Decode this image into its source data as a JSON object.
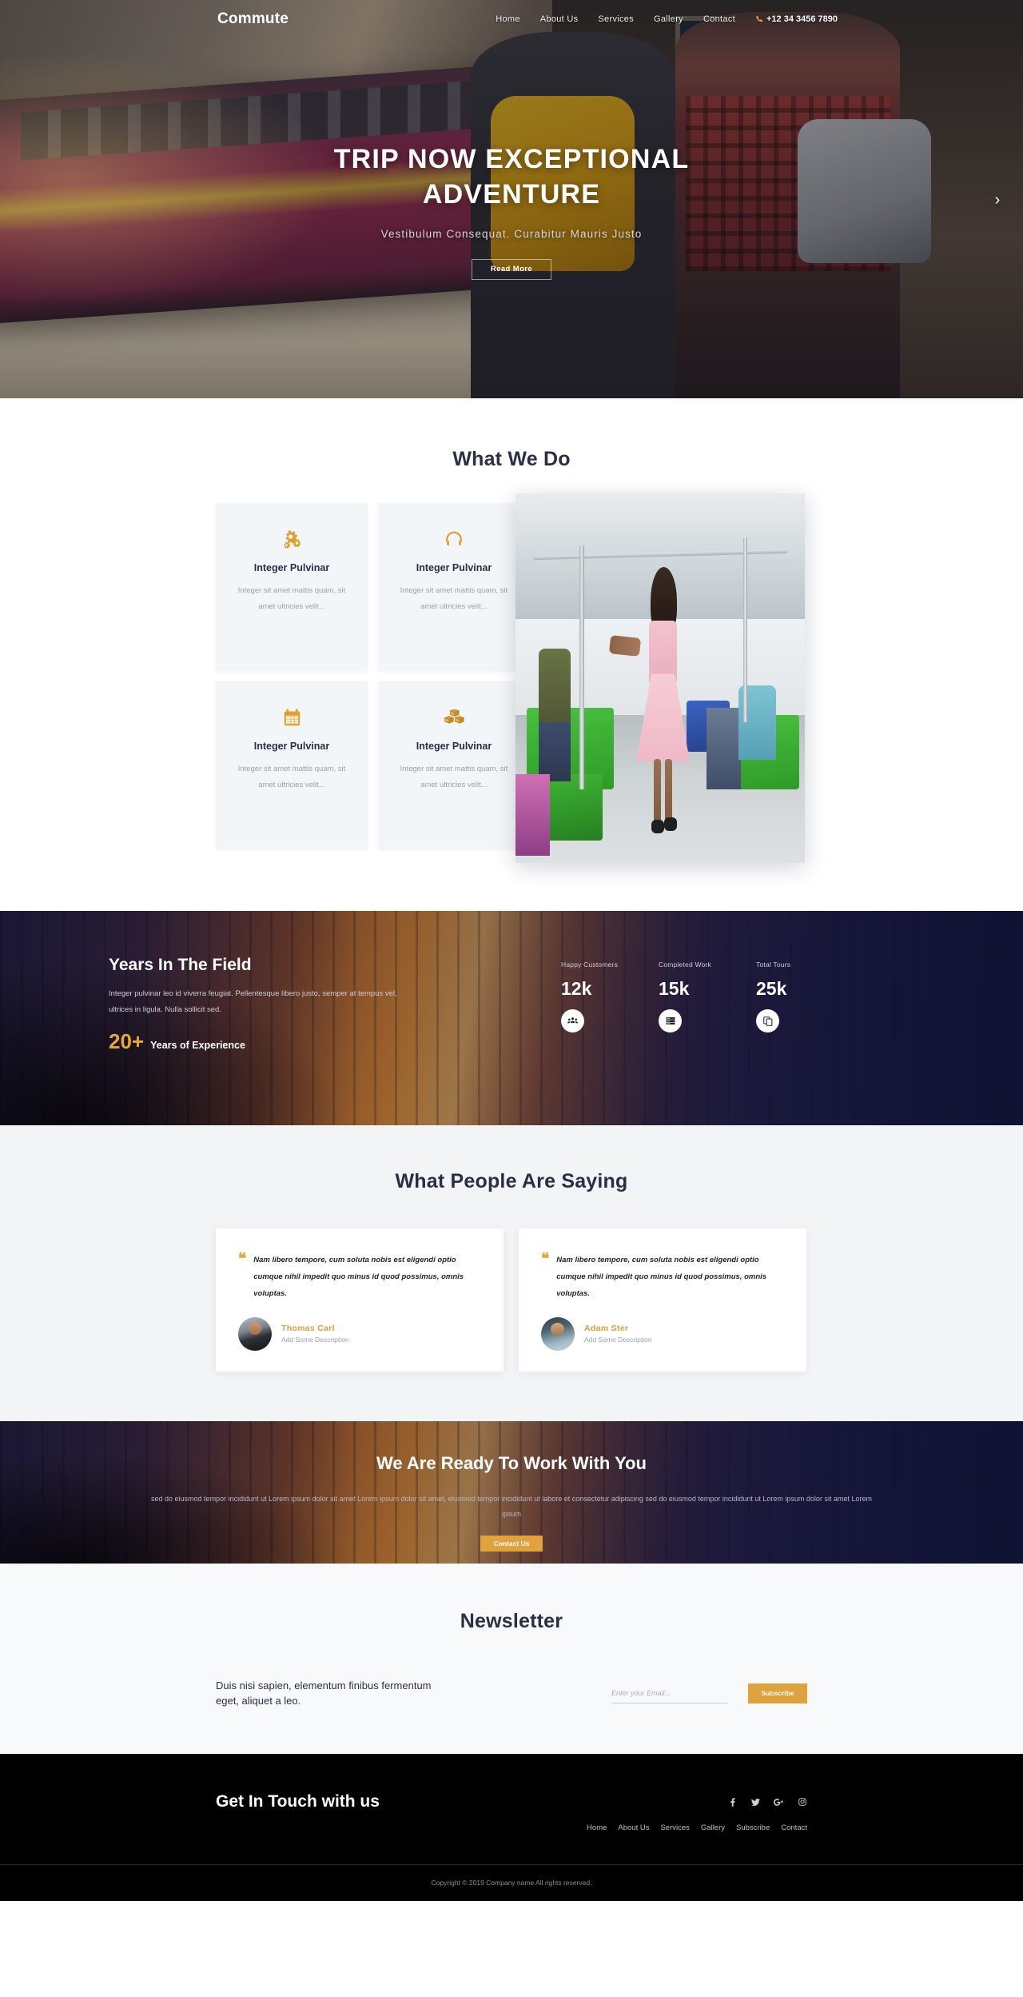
{
  "nav": {
    "logo": "Commute",
    "links": [
      "Home",
      "About Us",
      "Services",
      "Gallery",
      "Contact"
    ],
    "phone": "+12 34 3456 7890",
    "phone_icon": "phone-icon"
  },
  "hero": {
    "title": "TRIP NOW EXCEPTIONAL ADVENTURE",
    "subtitle": "Vestibulum Consequat. Curabitur Mauris Justo",
    "button": "Read More",
    "next_icon": "chevron-right-icon"
  },
  "what_we_do": {
    "title": "What We Do",
    "cards": [
      {
        "icon": "gears-icon",
        "title": "Integer Pulvinar",
        "text": "Integer sit amet mattis quam, sit amet ultricies velit..."
      },
      {
        "icon": "headphones-icon",
        "title": "Integer Pulvinar",
        "text": "Integer sit amet mattis quam, sit amet ultricies velit..."
      },
      {
        "icon": "calendar-icon",
        "title": "Integer Pulvinar",
        "text": "Integer sit amet mattis quam, sit amet ultricies velit..."
      },
      {
        "icon": "boxes-icon",
        "title": "Integer Pulvinar",
        "text": "Integer sit amet mattis quam, sit amet ultricies velit..."
      }
    ],
    "scroll_top_icon": "chevron-up-icon"
  },
  "stats": {
    "heading": "Years In The Field",
    "paragraph": "Integer pulvinar leo id viverra feugiat. Pellentesque libero justo, semper at tempus vel, ultrices in ligula. Nulla sollicit sed.",
    "experience_number": "20+",
    "experience_label": "Years of Experience",
    "items": [
      {
        "label": "Happy Customers",
        "value": "12k",
        "icon": "users-group-icon"
      },
      {
        "label": "Completed Work",
        "value": "15k",
        "icon": "server-icon"
      },
      {
        "label": "Total Tours",
        "value": "25k",
        "icon": "copy-files-icon"
      }
    ]
  },
  "testimonials": {
    "title": "What People Are Saying",
    "items": [
      {
        "quote": "Nam libero tempore, cum soluta nobis est eligendi optio cumque nihil impedit quo minus id quod possimus, omnis voluptas.",
        "name": "Thomas Carl",
        "description": "Add Some Description",
        "avatar": "avatar-thomas"
      },
      {
        "quote": "Nam libero tempore, cum soluta nobis est eligendi optio cumque nihil impedit quo minus id quod possimus, omnis voluptas.",
        "name": "Adam Ster",
        "description": "Add Some Description",
        "avatar": "avatar-adam"
      }
    ],
    "quote_mark": "“"
  },
  "cta": {
    "heading": "We Are Ready To Work With You",
    "paragraph": "sed do eiusmod tempor incididunt ut Lorem ipsum dolor sit amet Lorem ipsum dolor sit amet, eiusmod tempor incididunt ut labore et consectetur adipiscing sed do eiusmod tempor incididunt ut Lorem ipsum dolor sit amet Lorem ipsum",
    "button": "Contact Us"
  },
  "newsletter": {
    "title": "Newsletter",
    "text": "Duis nisi sapien, elementum finibus fermentum eget, aliquet a leo.",
    "input_placeholder": "Enter your Email...",
    "input_value": "",
    "button": "Subscribe"
  },
  "footer": {
    "heading": "Get In Touch with us",
    "socials": [
      {
        "name": "facebook-icon",
        "glyph": "f"
      },
      {
        "name": "twitter-icon",
        "glyph": "ᴠ"
      },
      {
        "name": "google-plus-icon",
        "glyph": "G+"
      },
      {
        "name": "instagram-icon",
        "glyph": "▢"
      }
    ],
    "links": [
      "Home",
      "About Us",
      "Services",
      "Gallery",
      "Subscribe",
      "Contact"
    ],
    "copyright": "Copyright © 2019 Company name All rights reserved."
  },
  "colors": {
    "accent": "#dfa23c",
    "dark_navy": "#1a1c3d",
    "heading": "#2b2f45"
  }
}
